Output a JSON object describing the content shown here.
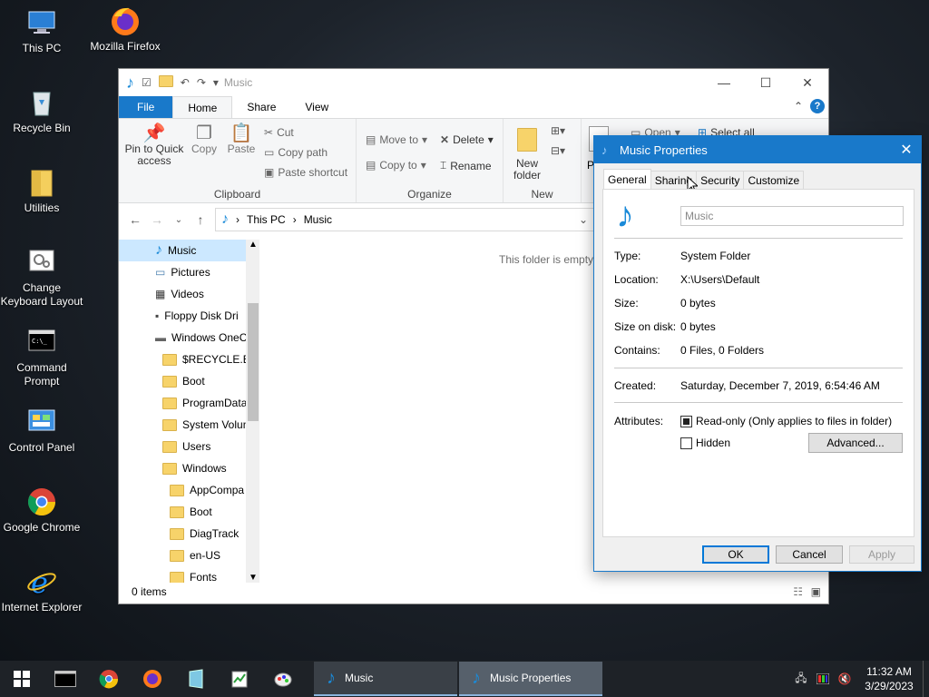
{
  "desktop": {
    "icons": [
      {
        "label": "This PC"
      },
      {
        "label": "Mozilla Firefox"
      },
      {
        "label": "Recycle Bin"
      },
      {
        "label": "Utilities"
      },
      {
        "label": "Change Keyboard Layout"
      },
      {
        "label": "Command Prompt"
      },
      {
        "label": "Control Panel"
      },
      {
        "label": "Google Chrome"
      },
      {
        "label": "Internet Explorer"
      }
    ]
  },
  "explorer": {
    "title": "Music",
    "tabs": {
      "file": "File",
      "home": "Home",
      "share": "Share",
      "view": "View"
    },
    "ribbon": {
      "clipboard": {
        "pin": "Pin to Quick access",
        "copy": "Copy",
        "paste": "Paste",
        "cut": "Cut",
        "copy_path": "Copy path",
        "paste_shortcut": "Paste shortcut",
        "label": "Clipboard"
      },
      "organize": {
        "move_to": "Move to",
        "copy_to": "Copy to",
        "delete": "Delete",
        "rename": "Rename",
        "label": "Organize"
      },
      "new": {
        "new_folder": "New folder",
        "label": "New"
      },
      "open": {
        "open": "Open",
        "select_all": "Select all",
        "p": "P"
      }
    },
    "address": {
      "this_pc": "This PC",
      "current": "Music"
    },
    "nav": [
      {
        "label": "Music",
        "selected": true
      },
      {
        "label": "Pictures"
      },
      {
        "label": "Videos"
      },
      {
        "label": "Floppy Disk Dri"
      },
      {
        "label": "Windows OneC"
      },
      {
        "label": "$RECYCLE.BIN"
      },
      {
        "label": "Boot"
      },
      {
        "label": "ProgramData"
      },
      {
        "label": "System Volum"
      },
      {
        "label": "Users"
      },
      {
        "label": "Windows"
      },
      {
        "label": "AppCompa"
      },
      {
        "label": "Boot"
      },
      {
        "label": "DiagTrack"
      },
      {
        "label": "en-US"
      },
      {
        "label": "Fonts"
      }
    ],
    "empty_message": "This folder is empty.",
    "status": "0 items"
  },
  "properties": {
    "title": "Music Properties",
    "tabs": [
      "General",
      "Sharing",
      "Security",
      "Customize"
    ],
    "name_value": "Music",
    "fields": {
      "type_label": "Type:",
      "type": "System Folder",
      "location_label": "Location:",
      "location": "X:\\Users\\Default",
      "size_label": "Size:",
      "size": "0 bytes",
      "size_on_disk_label": "Size on disk:",
      "size_on_disk": "0 bytes",
      "contains_label": "Contains:",
      "contains": "0 Files, 0 Folders",
      "created_label": "Created:",
      "created": "Saturday, December 7, 2019, 6:54:46 AM",
      "attributes_label": "Attributes:"
    },
    "readonly_label": "Read-only (Only applies to files in folder)",
    "readonly_checked": true,
    "hidden_label": "Hidden",
    "hidden_checked": false,
    "advanced_button": "Advanced...",
    "ok": "OK",
    "cancel": "Cancel",
    "apply": "Apply"
  },
  "taskbar": {
    "apps": [
      {
        "label": "Music"
      },
      {
        "label": "Music Properties"
      }
    ],
    "time": "11:32 AM",
    "date": "3/29/2023"
  }
}
